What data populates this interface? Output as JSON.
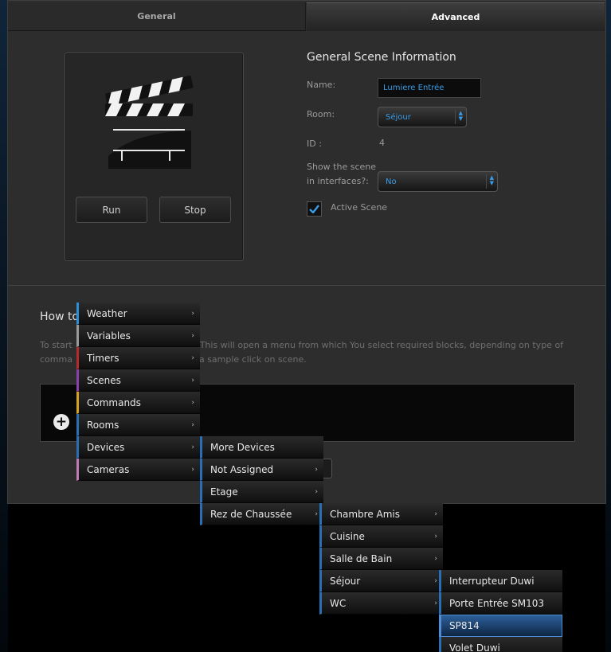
{
  "tabs": [
    {
      "label": "General",
      "active": false
    },
    {
      "label": "Advanced",
      "active": true
    }
  ],
  "scene": {
    "run_label": "Run",
    "stop_label": "Stop"
  },
  "info": {
    "title": "General Scene Information",
    "name_label": "Name:",
    "name_value": "Lumiere Entrée",
    "room_label": "Room:",
    "room_value": "Séjour",
    "id_label": "ID :",
    "id_value": "4",
    "show_label_line1": "Show the scene",
    "show_label_line2": "in interfaces?:",
    "show_value": "No",
    "active_label": "Active Scene",
    "active_checked": true
  },
  "howto": {
    "title": "How to",
    "desc_line1_a": "To start",
    "desc_line1_b": ". This will open a menu from which You select required blocks, depending on type of",
    "desc_line2_a": "comma",
    "desc_line2_b": "a sample click on scene."
  },
  "menu": {
    "level1": [
      {
        "label": "Weather",
        "color": "#2a8fd6"
      },
      {
        "label": "Variables",
        "color": "#9a9a9a"
      },
      {
        "label": "Timers",
        "color": "#b52a2a"
      },
      {
        "label": "Scenes",
        "color": "#8a3fb0"
      },
      {
        "label": "Commands",
        "color": "#d4a21c"
      },
      {
        "label": "Rooms",
        "color": "#2a6fb5"
      },
      {
        "label": "Devices",
        "color": "#2a6fb5"
      },
      {
        "label": "Cameras",
        "color": "#c07ab8"
      }
    ],
    "level2": [
      {
        "label": "More Devices",
        "has_submenu": false
      },
      {
        "label": "Not Assigned",
        "has_submenu": true
      },
      {
        "label": "Etage",
        "has_submenu": true
      },
      {
        "label": "Rez de Chaussée",
        "has_submenu": true
      }
    ],
    "level3": [
      {
        "label": "Chambre Amis"
      },
      {
        "label": "Cuisine"
      },
      {
        "label": "Salle de Bain"
      },
      {
        "label": "Séjour"
      },
      {
        "label": "WC"
      }
    ],
    "level4": [
      {
        "label": "Interrupteur Duwi",
        "selected": false
      },
      {
        "label": "Porte Entrée SM103",
        "selected": false
      },
      {
        "label": "SP814",
        "selected": true
      },
      {
        "label": "Volet Duwi",
        "selected": false
      }
    ]
  },
  "colors": {
    "accent": "#3a9be6",
    "panel": "#2d2d2d",
    "menu_selected": "#2d5f9a"
  }
}
